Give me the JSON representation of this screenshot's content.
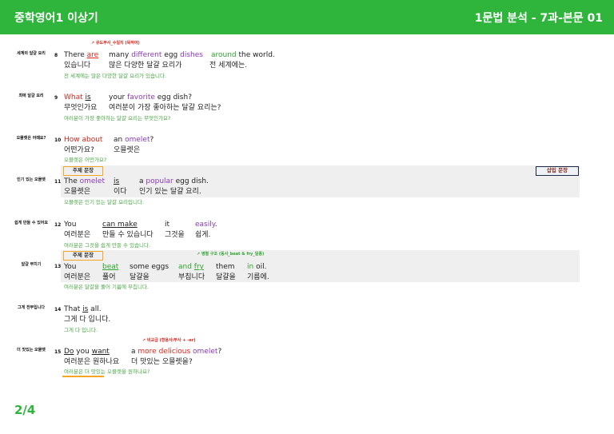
{
  "header": {
    "title": "중학영어1 이상기",
    "section": "1문법 분석 - 7과-본문 01"
  },
  "page": "2/4",
  "badges": {
    "topic": "주제 문장",
    "insert": "삽입 문장"
  },
  "notes": {
    "n8": "유도부사_수일치 (목적어)",
    "n13": "병렬 구조 (동사_beat & fry_일종)",
    "n15": "비교급 (형용사/부사 + -er)"
  },
  "entries": [
    {
      "num": "8",
      "gloss": "세계의 달걀 요리",
      "en": [
        "There ",
        "are",
        "many ",
        "different",
        " egg ",
        "dishes",
        "around",
        " the world."
      ],
      "ko": [
        "있습니다",
        "많은 다양한 달걀 요리가",
        "전 세계에는."
      ],
      "tr": "전 세계에는 많은 다양한 달걀 요리가 있습니다."
    },
    {
      "num": "9",
      "gloss": "최애 달걀 요리",
      "en": [
        "What ",
        "is",
        "your ",
        "favorite",
        " egg dish?"
      ],
      "ko": [
        "무엇인가요",
        "여러분이 가장 좋아하는 달걀 요리는?"
      ],
      "tr": "여러분이 가장 좋아하는 달걀 요리는 무엇인가요?"
    },
    {
      "num": "10",
      "gloss": "오믈렛은 어때요?",
      "en": [
        "How about",
        "an ",
        "omelet",
        "?"
      ],
      "ko": [
        "어떤가요?",
        "오믈렛은"
      ],
      "tr": "오믈렛은 어떤가요?"
    },
    {
      "num": "11",
      "gloss": "인기 있는 오믈렛",
      "en": [
        "The ",
        "omelet",
        "is",
        "a ",
        "popular",
        " egg dish."
      ],
      "ko": [
        "오믈렛은",
        "이다",
        "인기 있는 달걀 요리."
      ],
      "tr": "오믈렛은 인기 있는 달걀 요리입니다."
    },
    {
      "num": "12",
      "gloss": "쉽게 만들 수 있어요",
      "en": [
        "You",
        "can make",
        "it",
        "easily",
        "."
      ],
      "ko": [
        "여러분은",
        "만들 수 있습니다",
        "그것을",
        "쉽게."
      ],
      "tr": "여러분은 그것을 쉽게 만들 수 있습니다."
    },
    {
      "num": "13",
      "gloss": "달걀 부치기",
      "en": [
        "You",
        "beat",
        "some eggs",
        "and ",
        "fry",
        "them",
        "in",
        " oil."
      ],
      "ko": [
        "여러분은",
        "풀어",
        "달걀을",
        "부칩니다",
        "달걀을",
        "기름에."
      ],
      "tr": "여러분은 달걀을 풀어 기름에 부칩니다."
    },
    {
      "num": "14",
      "gloss": "그게 전부입니다",
      "en": [
        "That ",
        "is",
        " all."
      ],
      "ko": [
        "그게 다 입니다."
      ],
      "tr": "그게 다 입니다."
    },
    {
      "num": "15",
      "gloss": "더 맛있는 오믈렛",
      "en": [
        "Do",
        " you ",
        "want",
        "a ",
        "more delicious",
        " ",
        "omelet",
        "?"
      ],
      "ko": [
        "여러분은 원하나요",
        "더 맛있는 오믈렛을?"
      ],
      "tr": "여러분은 더 맛있는 오믈렛을 원하나요?"
    }
  ]
}
